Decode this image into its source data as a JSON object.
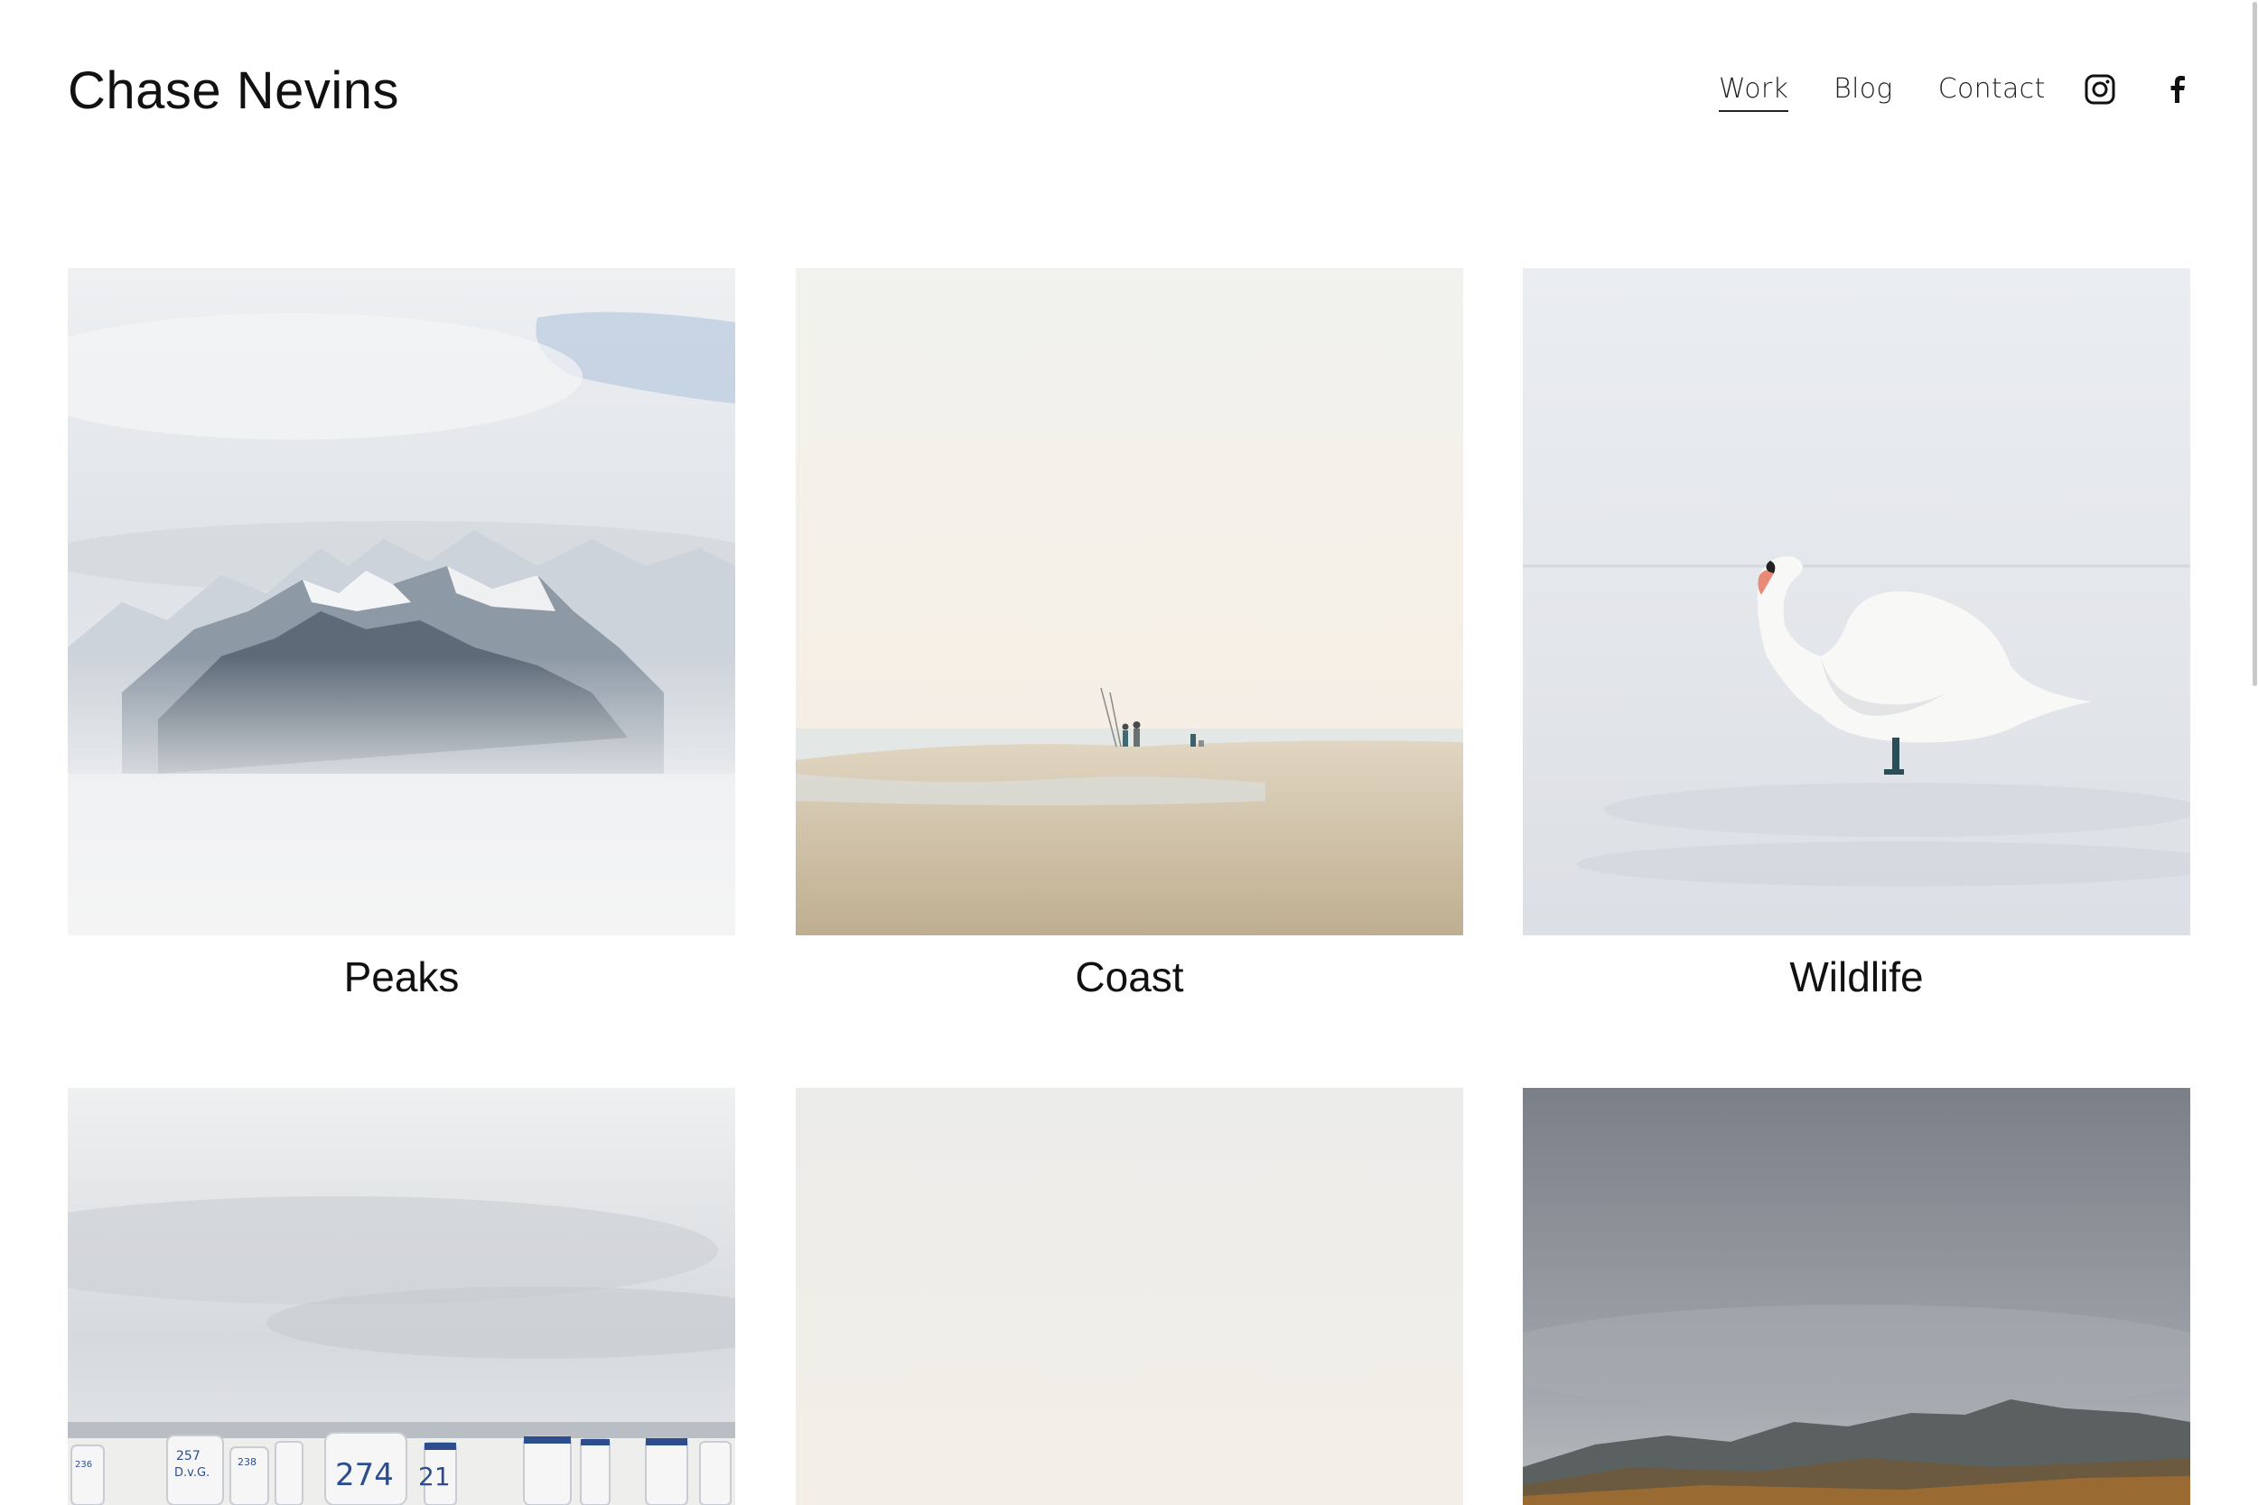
{
  "site": {
    "title": "Chase Nevins"
  },
  "nav": {
    "items": [
      {
        "label": "Work",
        "active": true
      },
      {
        "label": "Blog",
        "active": false
      },
      {
        "label": "Contact",
        "active": false
      }
    ]
  },
  "social": {
    "icons": [
      "instagram-icon",
      "facebook-icon"
    ]
  },
  "gallery": {
    "items": [
      {
        "title": "Peaks"
      },
      {
        "title": "Coast"
      },
      {
        "title": "Wildlife"
      },
      {
        "title": ""
      },
      {
        "title": ""
      },
      {
        "title": ""
      }
    ]
  },
  "beach_chairs": {
    "labels": [
      "257",
      "D.v.G.",
      "274",
      "236",
      "238",
      "21"
    ]
  },
  "colors": {
    "text": "#111111",
    "background": "#ffffff",
    "scrollbar": "#c9c9c9"
  }
}
